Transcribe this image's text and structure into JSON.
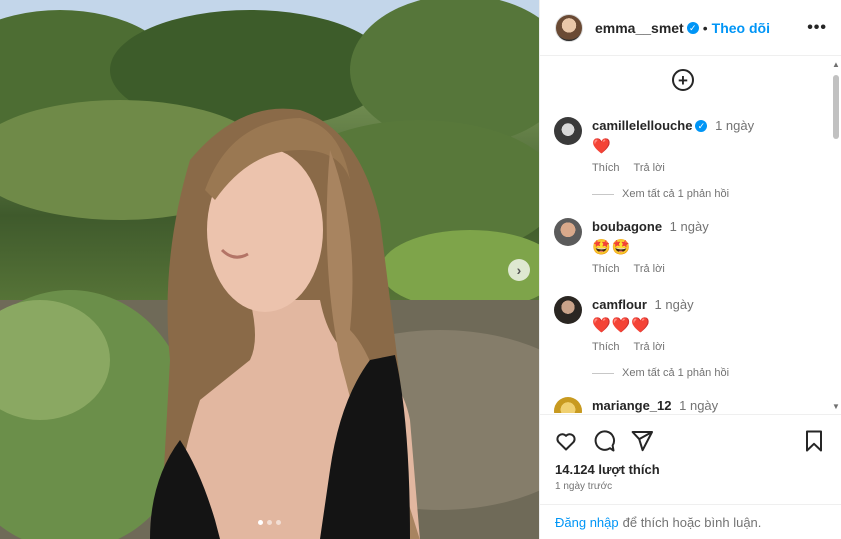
{
  "post": {
    "author": "emma__smet",
    "separator": "•",
    "follow_label": "Theo dõi",
    "more_icon": "more-horizontal-icon",
    "carousel": {
      "slide_count": 3,
      "active_slide": 1
    }
  },
  "comments": [
    {
      "user": "camillelellouche",
      "verified": true,
      "time": "1 ngày",
      "text": "❤️",
      "like": "Thích",
      "reply": "Trả lời",
      "view_replies": "Xem tất cả 1 phản hồi"
    },
    {
      "user": "boubagone",
      "verified": false,
      "time": "1 ngày",
      "text": "🤩🤩",
      "like": "Thích",
      "reply": "Trả lời"
    },
    {
      "user": "camflour",
      "verified": false,
      "time": "1 ngày",
      "text": "❤️❤️❤️",
      "like": "Thích",
      "reply": "Trả lời",
      "view_replies": "Xem tất cả 1 phản hồi"
    },
    {
      "user": "mariange_12",
      "verified": false,
      "time": "1 ngày"
    }
  ],
  "stats": {
    "likes": "14.124 lượt thích",
    "posted": "1 ngày trước"
  },
  "login": {
    "link": "Đăng nhập",
    "text": "để thích hoặc bình luận."
  },
  "colors": {
    "accent": "#0095f6",
    "heart": "#ed4956",
    "muted": "#737373"
  }
}
